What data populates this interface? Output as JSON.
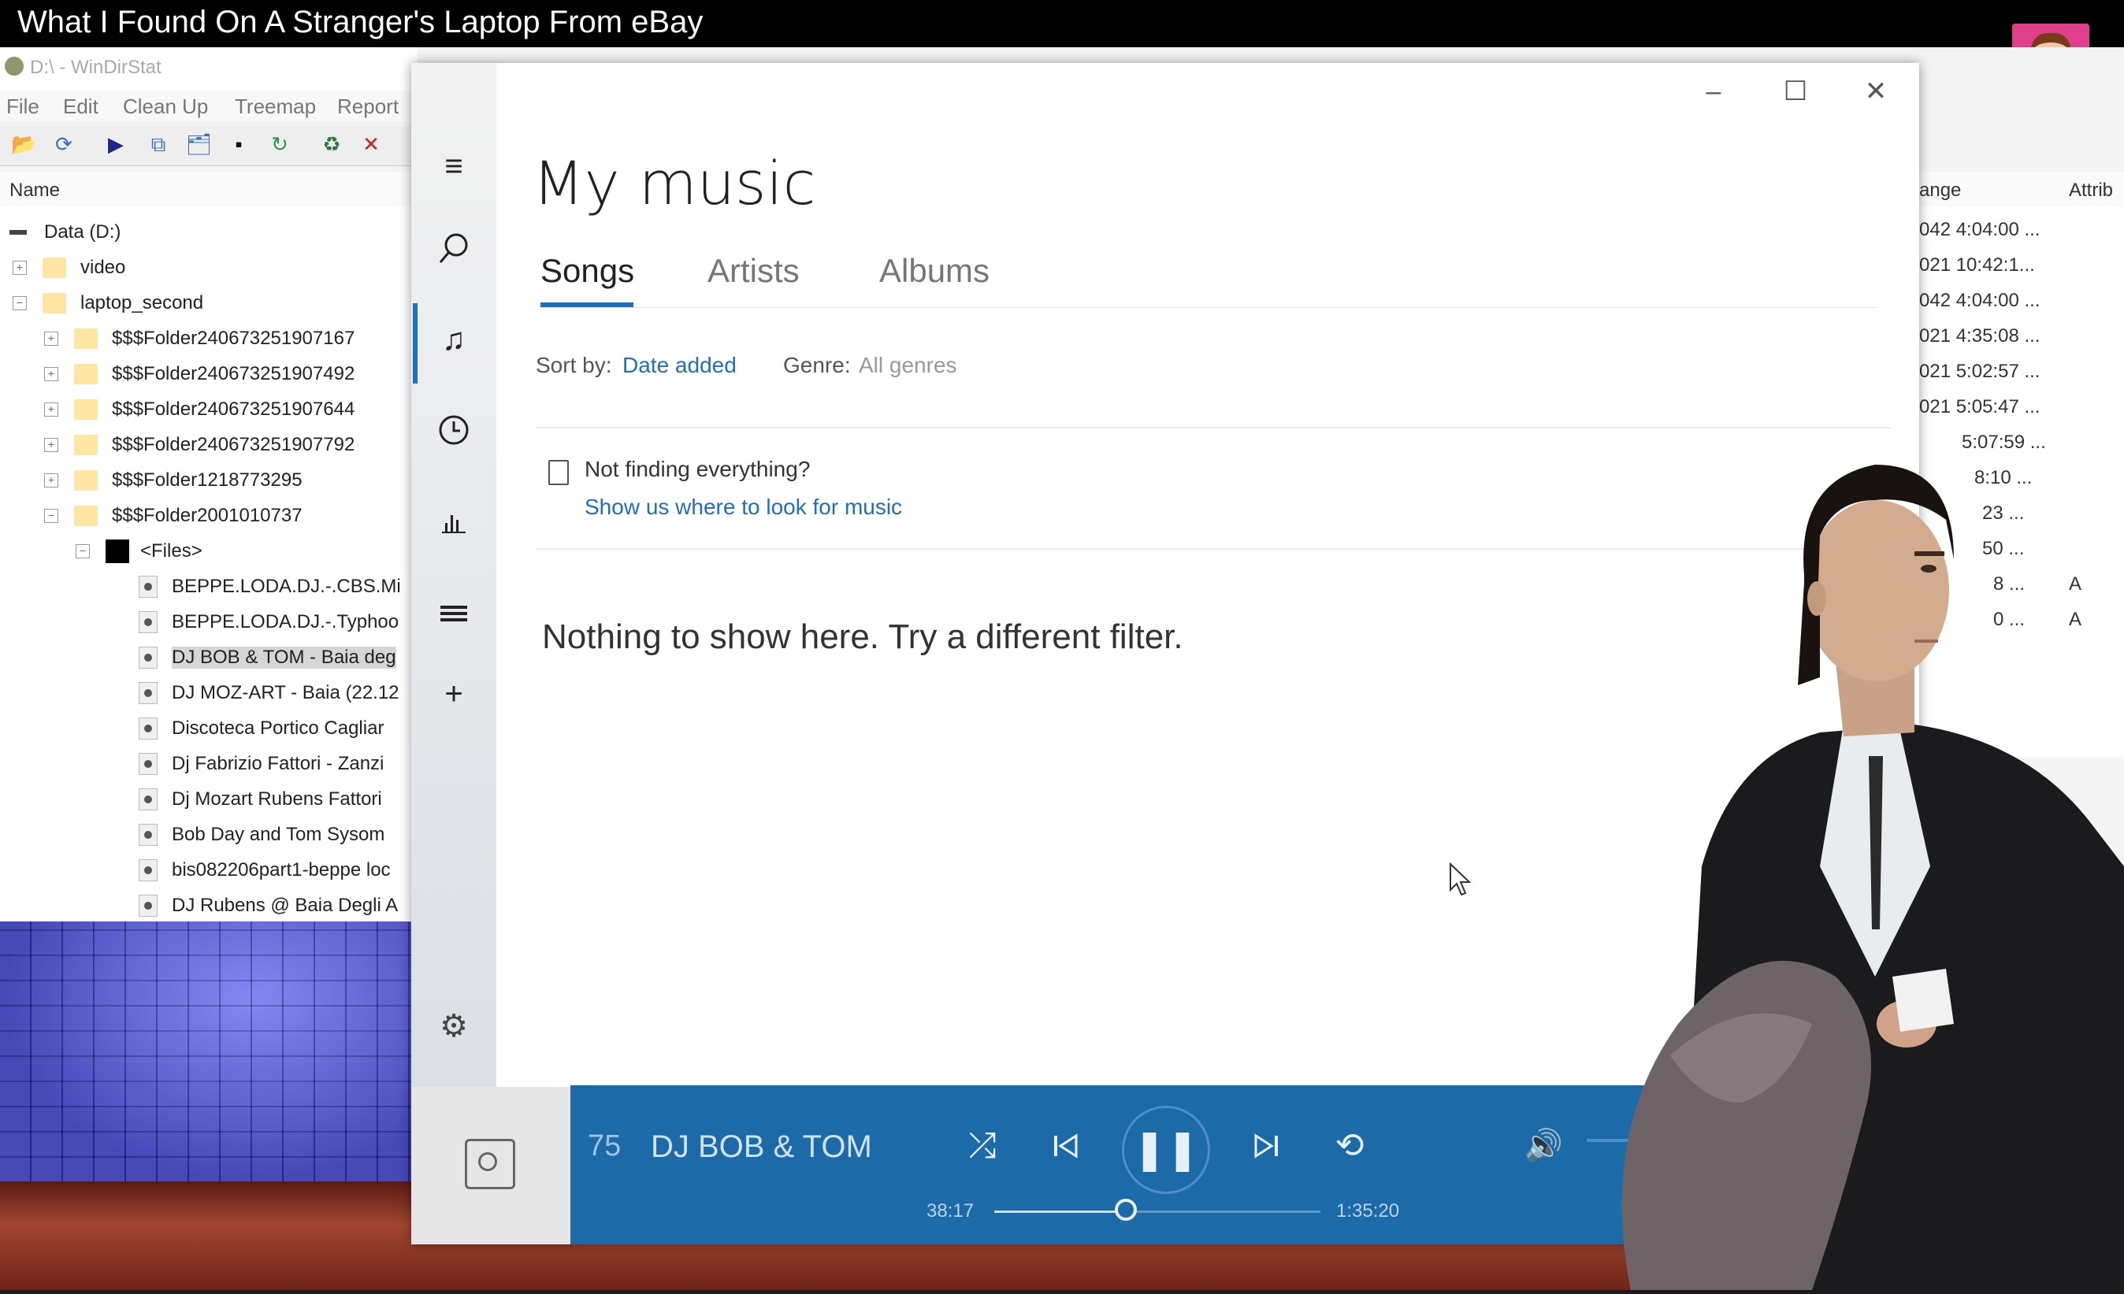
{
  "video": {
    "title": "What I Found On A Stranger's Laptop From eBay"
  },
  "windirstat": {
    "title": "D:\\ - WinDirStat",
    "menu": [
      "File",
      "Edit",
      "Clean Up",
      "Treemap",
      "Report"
    ],
    "tree_header": "Name",
    "tree": [
      {
        "label": "Data (D:)",
        "type": "drive"
      },
      {
        "label": "video",
        "type": "folder"
      },
      {
        "label": "laptop_second",
        "type": "folder"
      },
      {
        "label": "$$$Folder240673251907167",
        "type": "folder"
      },
      {
        "label": "$$$Folder240673251907492",
        "type": "folder"
      },
      {
        "label": "$$$Folder240673251907644",
        "type": "folder"
      },
      {
        "label": "$$$Folder240673251907792",
        "type": "folder"
      },
      {
        "label": "$$$Folder1218773295",
        "type": "folder"
      },
      {
        "label": "$$$Folder2001010737",
        "type": "folder"
      },
      {
        "label": "<Files>",
        "type": "files"
      },
      {
        "label": "BEPPE.LODA.DJ.-.CBS.Mi",
        "type": "file"
      },
      {
        "label": "BEPPE.LODA.DJ.-.Typhoo",
        "type": "file"
      },
      {
        "label": "DJ BOB & TOM - Baia deg",
        "type": "file"
      },
      {
        "label": "DJ MOZ-ART - Baia (22.12",
        "type": "file"
      },
      {
        "label": "Discoteca Portico Cagliar",
        "type": "file"
      },
      {
        "label": "Dj Fabrizio Fattori - Zanzi",
        "type": "file"
      },
      {
        "label": "Dj Mozart Rubens Fattori",
        "type": "file"
      },
      {
        "label": "Bob Day and Tom Sysom",
        "type": "file"
      },
      {
        "label": "bis082206part1-beppe loc",
        "type": "file"
      },
      {
        "label": "DJ Rubens @ Baia Degli A",
        "type": "file"
      }
    ],
    "right_headers": [
      "ange",
      "Attrib"
    ],
    "right_rows": [
      {
        "date": "042 4:04:00 ...",
        "attr": ""
      },
      {
        "date": "021 10:42:1...",
        "attr": ""
      },
      {
        "date": "042 4:04:00 ...",
        "attr": ""
      },
      {
        "date": "021 4:35:08 ...",
        "attr": ""
      },
      {
        "date": "021 5:02:57 ...",
        "attr": ""
      },
      {
        "date": "021 5:05:47 ...",
        "attr": ""
      },
      {
        "date": "5:07:59 ...",
        "attr": ""
      },
      {
        "date": "8:10 ...",
        "attr": ""
      },
      {
        "date": "23 ...",
        "attr": ""
      },
      {
        "date": "50 ...",
        "attr": ""
      },
      {
        "date": "8 ...",
        "attr": "A"
      },
      {
        "date": "0 ...",
        "attr": "A"
      }
    ]
  },
  "groove": {
    "title": "My music",
    "tabs": [
      "Songs",
      "Artists",
      "Albums"
    ],
    "active_tab": "Songs",
    "sort_label": "Sort by:",
    "sort_value": "Date added",
    "genre_label": "Genre:",
    "genre_value": "All genres",
    "not_finding": "Not finding everything?",
    "show_link": "Show us where to look for music",
    "empty_message": "Nothing to show here. Try a different filter.",
    "nav_icons": [
      "hamburger-icon",
      "search-icon",
      "music-note-icon",
      "recent-clock-icon",
      "bar-chart-icon",
      "playlist-icon",
      "add-icon",
      "settings-icon"
    ],
    "window_controls": {
      "minimize": "–",
      "maximize": "☐",
      "close": "✕"
    }
  },
  "now_playing": {
    "track_no": "75",
    "artist": "DJ BOB & TOM",
    "elapsed": "38:17",
    "total": "1:35:20",
    "progress": 0.4026,
    "state": "playing",
    "accent": "#1d6aa8"
  }
}
